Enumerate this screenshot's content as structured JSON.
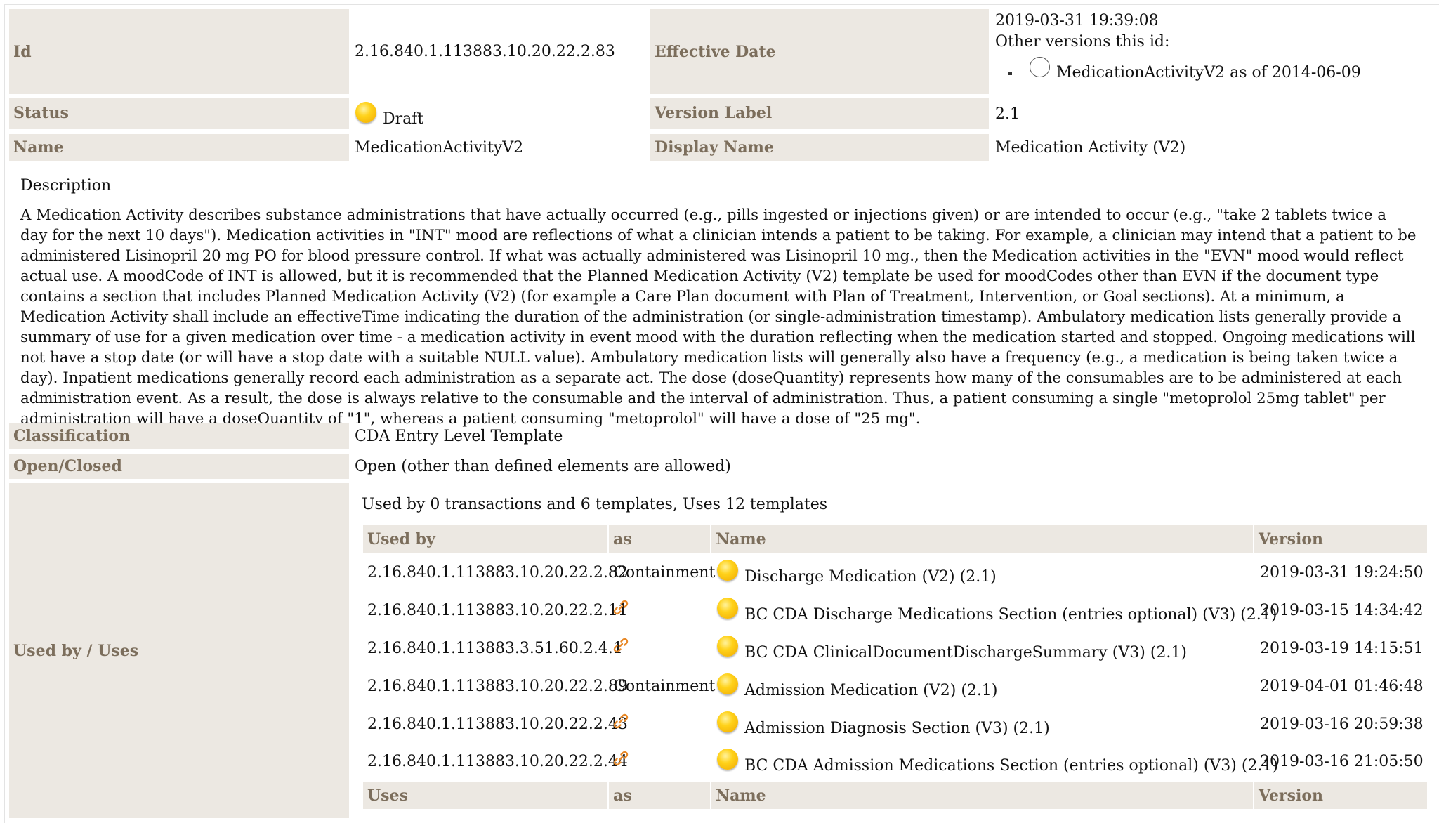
{
  "header": {
    "id_label": "Id",
    "id_value": "2.16.840.1.113883.10.20.22.2.83",
    "effective_date_label": "Effective Date",
    "effective_date_value": "2019-03-31 19:39:08",
    "other_versions_label": "Other versions this id:",
    "other_version_link": "MedicationActivityV2 as of 2014-06-09",
    "status_label": "Status",
    "status_value": "Draft",
    "version_label_label": "Version Label",
    "version_label_value": "2.1",
    "name_label": "Name",
    "name_value": "MedicationActivityV2",
    "display_name_label": "Display Name",
    "display_name_value": "Medication Activity (V2)"
  },
  "description": {
    "heading": "Description",
    "text": "A Medication Activity describes substance administrations that have actually occurred (e.g., pills ingested or injections given) or are intended to occur (e.g., \"take 2 tablets twice a day for the next 10 days\"). Medication activities in \"INT\" mood are reflections of what a clinician intends a patient to be taking. For example, a clinician may intend that a patient to be administered Lisinopril 20 mg PO for blood pressure control. If what was actually administered was Lisinopril 10 mg., then the Medication activities in the \"EVN\" mood would reflect actual use. A moodCode of INT is allowed, but it is recommended that the Planned Medication Activity (V2) template be used for moodCodes other than EVN if the document type contains a section that includes Planned Medication Activity (V2) (for example a Care Plan document with Plan of Treatment, Intervention, or Goal sections). At a minimum, a Medication Activity shall include an effectiveTime indicating the duration of the administration (or single-administration timestamp). Ambulatory medication lists generally provide a summary of use for a given medication over time - a medication activity in event mood with the duration reflecting when the medication started and stopped. Ongoing medications will not have a stop date (or will have a stop date with a suitable NULL value). Ambulatory medication lists will generally also have a frequency (e.g., a medication is being taken twice a day). Inpatient medications generally record each administration as a separate act. The dose (doseQuantity) represents how many of the consumables are to be administered at each administration event. As a result, the dose is always relative to the consumable and the interval of administration. Thus, a patient consuming a single \"metoprolol 25mg tablet\" per administration will have a doseQuantity of \"1\", whereas a patient consuming \"metoprolol\" will have a dose of \"25 mg\"."
  },
  "classification": {
    "label": "Classification",
    "value": "CDA Entry Level Template"
  },
  "open_closed": {
    "label": "Open/Closed",
    "value": "Open (other than defined elements are allowed)"
  },
  "used_by_uses": {
    "label": "Used by / Uses",
    "summary": "Used by 0 transactions and 6 templates, Uses 12 templates",
    "used_by_headers": [
      "Used by",
      "as",
      "Name",
      "Version"
    ],
    "rows": [
      {
        "id": "2.16.840.1.113883.10.20.22.2.82",
        "as": "Containment",
        "as_icon": "",
        "name": "Discharge Medication (V2) (2.1)",
        "version": "2019-03-31 19:24:50"
      },
      {
        "id": "2.16.840.1.113883.10.20.22.2.11",
        "as": "",
        "as_icon": "link-icon",
        "name": "BC CDA Discharge Medications Section (entries optional) (V3) (2.1)",
        "version": "2019-03-15 14:34:42"
      },
      {
        "id": "2.16.840.1.113883.3.51.60.2.4.1",
        "as": "",
        "as_icon": "link-icon",
        "name": "BC CDA ClinicalDocumentDischargeSummary (V3) (2.1)",
        "version": "2019-03-19 14:15:51"
      },
      {
        "id": "2.16.840.1.113883.10.20.22.2.89",
        "as": "Containment",
        "as_icon": "",
        "name": "Admission Medication (V2) (2.1)",
        "version": "2019-04-01 01:46:48"
      },
      {
        "id": "2.16.840.1.113883.10.20.22.2.43",
        "as": "",
        "as_icon": "link-icon",
        "name": "Admission Diagnosis Section (V3) (2.1)",
        "version": "2019-03-16 20:59:38"
      },
      {
        "id": "2.16.840.1.113883.10.20.22.2.44",
        "as": "",
        "as_icon": "link-icon",
        "name": "BC CDA Admission Medications Section (entries optional) (V3) (2.1)",
        "version": "2019-03-16 21:05:50"
      }
    ],
    "uses_headers": [
      "Uses",
      "as",
      "Name",
      "Version"
    ]
  },
  "colors": {
    "label_bg": "#ece8e2",
    "label_text": "#7c6e5c",
    "status_draft": "#ffd21a",
    "link_icon": "#e88a2a"
  }
}
